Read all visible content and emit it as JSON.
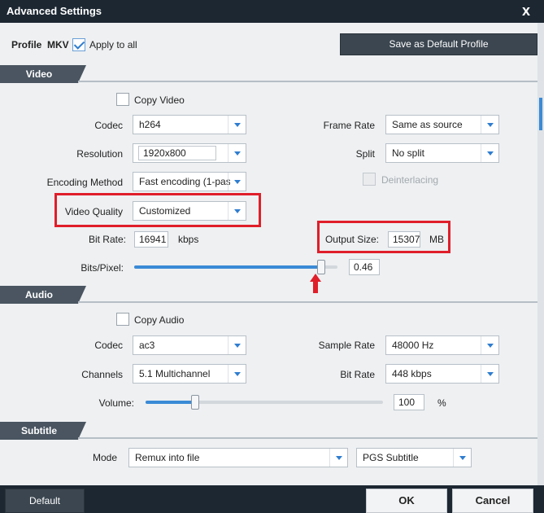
{
  "window": {
    "title": "Advanced Settings",
    "close_label": "x"
  },
  "profile": {
    "label": "Profile",
    "value": "MKV",
    "apply_all_label": "Apply to all",
    "apply_all_checked": true,
    "save_default_label": "Save as Default Profile"
  },
  "video": {
    "section_label": "Video",
    "copy_video_label": "Copy Video",
    "codec_label": "Codec",
    "codec_value": "h264",
    "resolution_label": "Resolution",
    "resolution_value": "1920x800",
    "encoding_label": "Encoding Method",
    "encoding_value": "Fast encoding (1-pas",
    "quality_label": "Video Quality",
    "quality_value": "Customized",
    "bitrate_label": "Bit Rate:",
    "bitrate_value": "16941",
    "bitrate_unit": "kbps",
    "bpp_label": "Bits/Pixel:",
    "bpp_value": "0.46",
    "bpp_fraction": 0.92,
    "framerate_label": "Frame Rate",
    "framerate_value": "Same as source",
    "split_label": "Split",
    "split_value": "No split",
    "deinterlacing_label": "Deinterlacing",
    "output_size_label": "Output Size:",
    "output_size_value": "15307",
    "output_size_unit": "MB"
  },
  "audio": {
    "section_label": "Audio",
    "copy_audio_label": "Copy Audio",
    "codec_label": "Codec",
    "codec_value": "ac3",
    "channels_label": "Channels",
    "channels_value": "5.1 Multichannel",
    "volume_label": "Volume:",
    "volume_value": "100",
    "volume_unit": "%",
    "volume_fraction": 0.21,
    "samplerate_label": "Sample Rate",
    "samplerate_value": "48000 Hz",
    "bitrate_label": "Bit Rate",
    "bitrate_value": "448 kbps"
  },
  "subtitle": {
    "section_label": "Subtitle",
    "mode_label": "Mode",
    "mode_value": "Remux into file",
    "format_value": "PGS Subtitle"
  },
  "footer": {
    "default_label": "Default",
    "ok_label": "OK",
    "cancel_label": "Cancel"
  },
  "colors": {
    "accent": "#3a8ad6",
    "highlight": "#e01e2a",
    "titlebar": "#1c2732"
  }
}
